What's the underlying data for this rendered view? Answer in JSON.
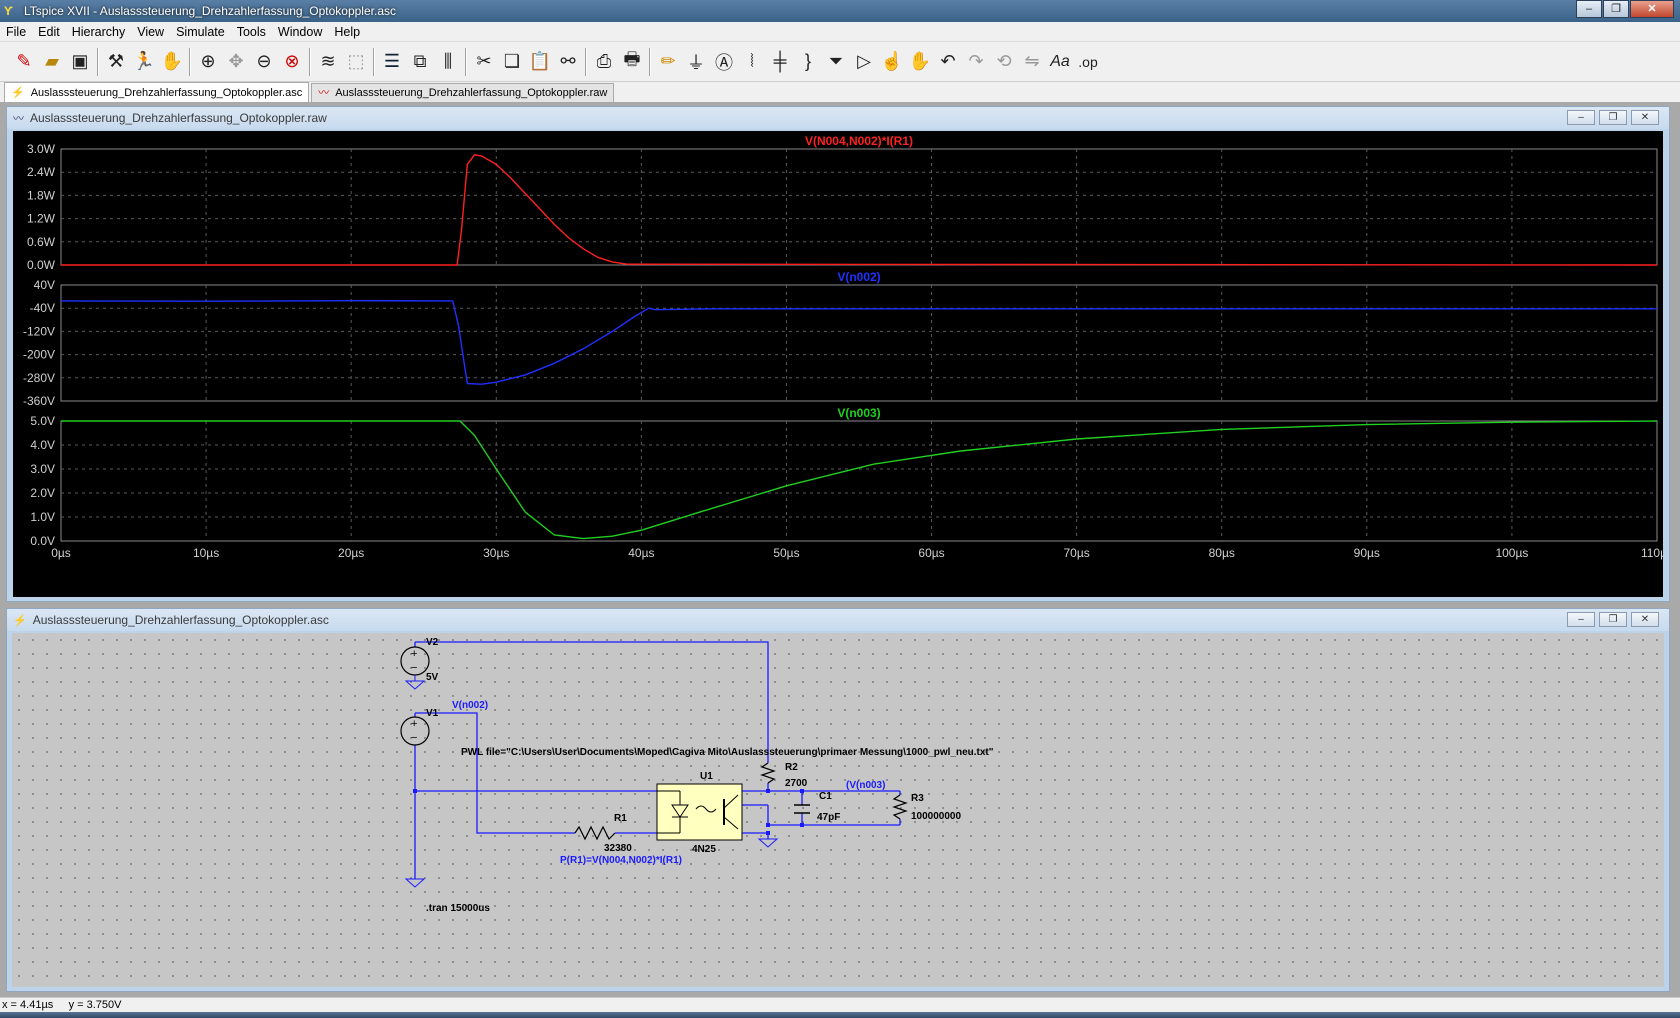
{
  "app": {
    "title": "LTspice XVII - Auslasssteuerung_Drehzahlerfassung_Optokoppler.asc"
  },
  "menu": [
    "File",
    "Edit",
    "Hierarchy",
    "View",
    "Simulate",
    "Tools",
    "Window",
    "Help"
  ],
  "tabs": [
    {
      "label": "Auslasssteuerung_Drehzahlerfassung_Optokoppler.asc",
      "icon": "schematic-icon",
      "active": true
    },
    {
      "label": "Auslasssteuerung_Drehzahlerfassung_Optokoppler.raw",
      "icon": "waveform-icon",
      "active": false
    }
  ],
  "toolbar": {
    "buttons": [
      "new-schematic",
      "open",
      "save",
      "control-panel",
      "run",
      "halt",
      "zoom-in",
      "pan",
      "zoom-out",
      "zoom-fit",
      "autorange",
      "zoom-back",
      "tile-horizontal",
      "cascade",
      "tile-vertical",
      "cut",
      "copy",
      "paste",
      "find",
      "print-setup",
      "print",
      "draw-wire",
      "ground",
      "label-net",
      "resistor",
      "capacitor",
      "inductor",
      "diode",
      "component",
      "move",
      "drag",
      "undo",
      "redo",
      "rotate",
      "mirror",
      "text",
      "spice-directive"
    ],
    "text_font_label": "Aa",
    "op_label": ".op"
  },
  "waveform_window": {
    "title": "Auslasssteuerung_Drehzahlerfassung_Optokoppler.raw"
  },
  "schematic_window": {
    "title": "Auslasssteuerung_Drehzahlerfassung_Optokoppler.asc",
    "labels": {
      "v2": "V2",
      "v2_value": "5V",
      "v1": "V1",
      "v1_net": "V(n002)",
      "pwl": "PWL file=\"C:\\Users\\User\\Documents\\Moped\\Cagiva Mito\\Auslasssteuerung\\primaer Messung\\1000_pwl_neu.txt\"",
      "r1": "R1",
      "r1_value": "32380",
      "r1_power": "P(R1)=V(N004,N002)*I(R1)",
      "u1": "U1",
      "u1_part": "4N25",
      "r2": "R2",
      "r2_value": "2700",
      "c1": "C1",
      "c1_value": "47pF",
      "c1_net": "(V(n003)",
      "r3": "R3",
      "r3_value": "100000000",
      "tran": ".tran 15000us"
    }
  },
  "status": {
    "x": "x = 4.41µs",
    "y": "y = 3.750V"
  },
  "colors": {
    "power": "#ff2020",
    "vn002": "#2030ff",
    "vn003": "#20d020",
    "wire": "#1a1aff",
    "grid": "#5a5a5a"
  },
  "chart_data": [
    {
      "type": "line",
      "title": "V(N004,N002)*I(R1)",
      "x_unit": "µs",
      "y_ticks": [
        "3.0W",
        "2.4W",
        "1.8W",
        "1.2W",
        "0.6W",
        "0.0W"
      ],
      "ylim": [
        0,
        3.0
      ],
      "xlim": [
        0,
        110
      ],
      "grid": true,
      "series": [
        {
          "name": "V(N004,N002)*I(R1)",
          "color": "#ff2020",
          "x": [
            0,
            27.3,
            27.6,
            28,
            28.5,
            29,
            30,
            31,
            32,
            33,
            34,
            35,
            36,
            37,
            38,
            39,
            110
          ],
          "y": [
            0,
            0,
            0.9,
            2.6,
            2.85,
            2.82,
            2.6,
            2.25,
            1.85,
            1.45,
            1.05,
            0.7,
            0.42,
            0.2,
            0.08,
            0.02,
            0
          ]
        }
      ]
    },
    {
      "type": "line",
      "title": "V(n002)",
      "y_ticks": [
        "40V",
        "-40V",
        "-120V",
        "-200V",
        "-280V",
        "-360V"
      ],
      "ylim": [
        -360,
        40
      ],
      "xlim": [
        0,
        110
      ],
      "grid": true,
      "series": [
        {
          "name": "V(n002)",
          "color": "#2030ff",
          "x": [
            0,
            10,
            20,
            27,
            27.4,
            28,
            29,
            30,
            32,
            34,
            36,
            38,
            39.5,
            40.5,
            41,
            45,
            60,
            80,
            110
          ],
          "y": [
            -15,
            -16,
            -14,
            -15,
            -100,
            -300,
            -302,
            -295,
            -270,
            -230,
            -180,
            -120,
            -70,
            -40,
            -45,
            -42,
            -42,
            -42,
            -42
          ]
        }
      ]
    },
    {
      "type": "line",
      "title": "V(n003)",
      "y_ticks": [
        "5.0V",
        "4.0V",
        "3.0V",
        "2.0V",
        "1.0V",
        "0.0V"
      ],
      "x_ticks": [
        "0µs",
        "10µs",
        "20µs",
        "30µs",
        "40µs",
        "50µs",
        "60µs",
        "70µs",
        "80µs",
        "90µs",
        "100µs",
        "110µs"
      ],
      "ylim": [
        0,
        5.0
      ],
      "xlim": [
        0,
        110
      ],
      "grid": true,
      "series": [
        {
          "name": "V(n003)",
          "color": "#20d020",
          "x": [
            0,
            27.5,
            28.5,
            30,
            32,
            34,
            36,
            38,
            40,
            44,
            50,
            56,
            62,
            70,
            80,
            90,
            100,
            110
          ],
          "y": [
            5,
            5,
            4.4,
            3,
            1.2,
            0.25,
            0.1,
            0.2,
            0.45,
            1.2,
            2.3,
            3.2,
            3.75,
            4.25,
            4.65,
            4.85,
            4.95,
            5
          ]
        }
      ]
    }
  ]
}
